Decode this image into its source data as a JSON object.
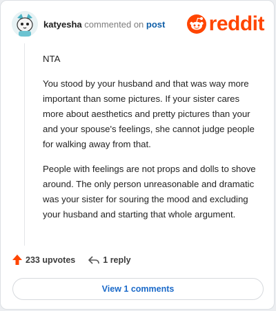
{
  "header": {
    "username": "katyesha",
    "verb": "commented on",
    "post_link": "post",
    "logo_text": "reddit",
    "avatar_icon": "avatar-cat-icon",
    "logo_icon": "reddit-snoo-icon"
  },
  "comment": {
    "paragraphs": [
      "NTA",
      "You stood by your husband and that was way more important than some pictures. If your sister cares more about aesthetics and pretty pictures than your and your spouse's feelings, she cannot judge people for walking away from that.",
      "People with feelings are not props and dolls to shove around. The only person unreasonable and dramatic was your sister for souring the mood and excluding your husband and starting that whole argument."
    ]
  },
  "actions": {
    "upvotes_label": "233 upvotes",
    "upvote_icon": "upvote-arrow-icon",
    "reply_label": "1 reply",
    "reply_icon": "reply-arrow-icon"
  },
  "view_comments_label": "View 1 comments",
  "colors": {
    "brand": "#ff4500",
    "link": "#0f5fa8",
    "button_text": "#1b6ac9"
  }
}
